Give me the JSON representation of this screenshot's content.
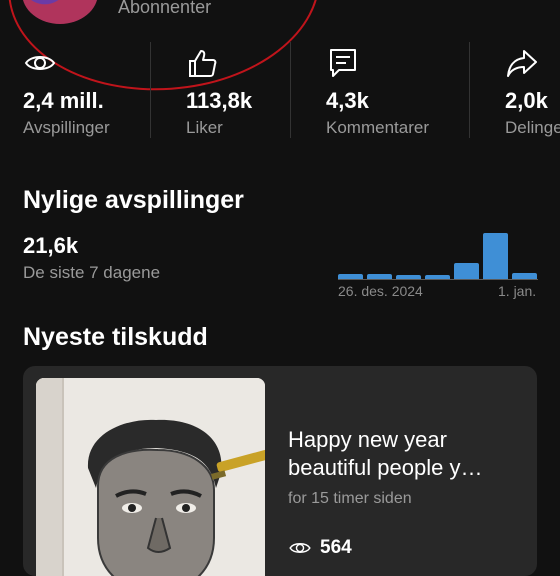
{
  "channel": {
    "subscribers_label": "Abonnenter"
  },
  "stats": [
    {
      "icon": "eye-icon",
      "value": "2,4 mill.",
      "label": "Avspillinger"
    },
    {
      "icon": "thumbs-up-icon",
      "value": "113,8k",
      "label": "Liker"
    },
    {
      "icon": "comment-icon",
      "value": "4,3k",
      "label": "Kommentarer"
    },
    {
      "icon": "share-icon",
      "value": "2,0k",
      "label": "Delinger"
    }
  ],
  "recent": {
    "title": "Nylige avspillinger",
    "value": "21,6k",
    "subtitle": "De siste 7 dagene"
  },
  "chart_data": {
    "type": "bar",
    "values": [
      5,
      5,
      4,
      4,
      15,
      44,
      6
    ],
    "x_tick_labels": [
      "26. des. 2024",
      "1. jan."
    ],
    "color": "#3f8fd6"
  },
  "latest": {
    "title": "Nyeste tilskudd",
    "card": {
      "title": "Happy new year beautiful people y…",
      "time": "for 15 timer siden",
      "views": "564"
    }
  }
}
